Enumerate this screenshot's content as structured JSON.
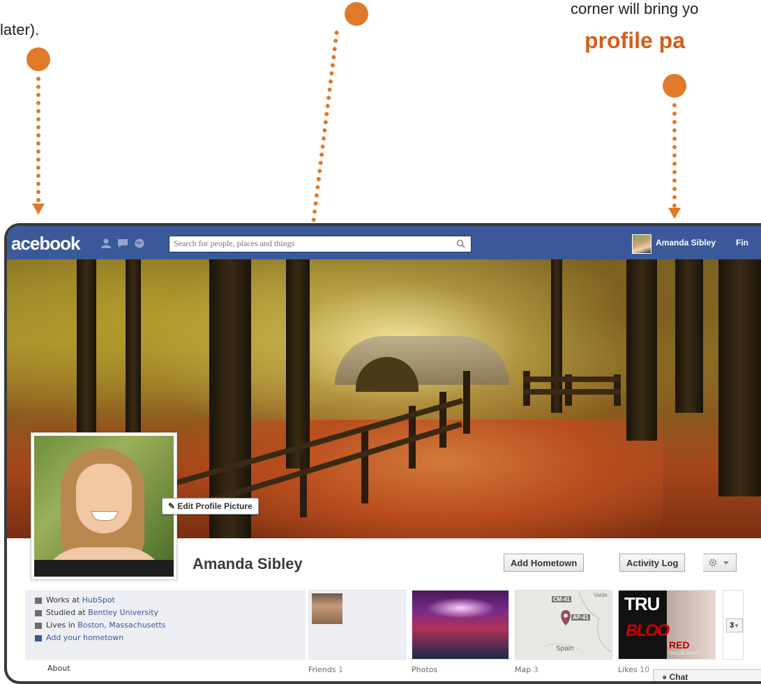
{
  "annotations": {
    "left_text": "later).",
    "right_text": "corner will bring yo",
    "right_highlight": "profile pa"
  },
  "topbar": {
    "logo": "acebook",
    "search_placeholder": "Search for people, places and things",
    "user_name": "Amanda Sibley",
    "find_label": "Fin"
  },
  "profile": {
    "name": "Amanda Sibley",
    "edit_picture_label": "Edit Profile Picture",
    "add_hometown_label": "Add Hometown",
    "activity_log_label": "Activity Log"
  },
  "info": {
    "works_prefix": "Works at ",
    "works_link": "HubSpot",
    "studied_prefix": "Studied at ",
    "studied_link": "Bentley University",
    "lives_prefix": "Lives in ",
    "lives_link": "Boston, Massachusetts",
    "add_hometown": "Add your hometown",
    "about": "About"
  },
  "tiles": {
    "friends_label": "Friends",
    "friends_count": "1",
    "photos_label": "Photos",
    "map_label": "Map",
    "map_count": "3",
    "likes_label": "Likes",
    "likes_count": "10",
    "map_marker_1": "CM-41",
    "map_marker_2": "AP-41",
    "map_place": "Spain",
    "map_corner": "Valde",
    "likes_art_1": "TRU",
    "likes_art_2": "BLOO",
    "likes_art_3": "RED",
    "likes_art_4": "TAYLOR SWIFT",
    "more_count": "3"
  },
  "chat": {
    "label": "Chat"
  },
  "colors": {
    "accent": "#e07a2a",
    "facebook_blue": "#3b5998",
    "highlight_text": "#d35f1d"
  }
}
